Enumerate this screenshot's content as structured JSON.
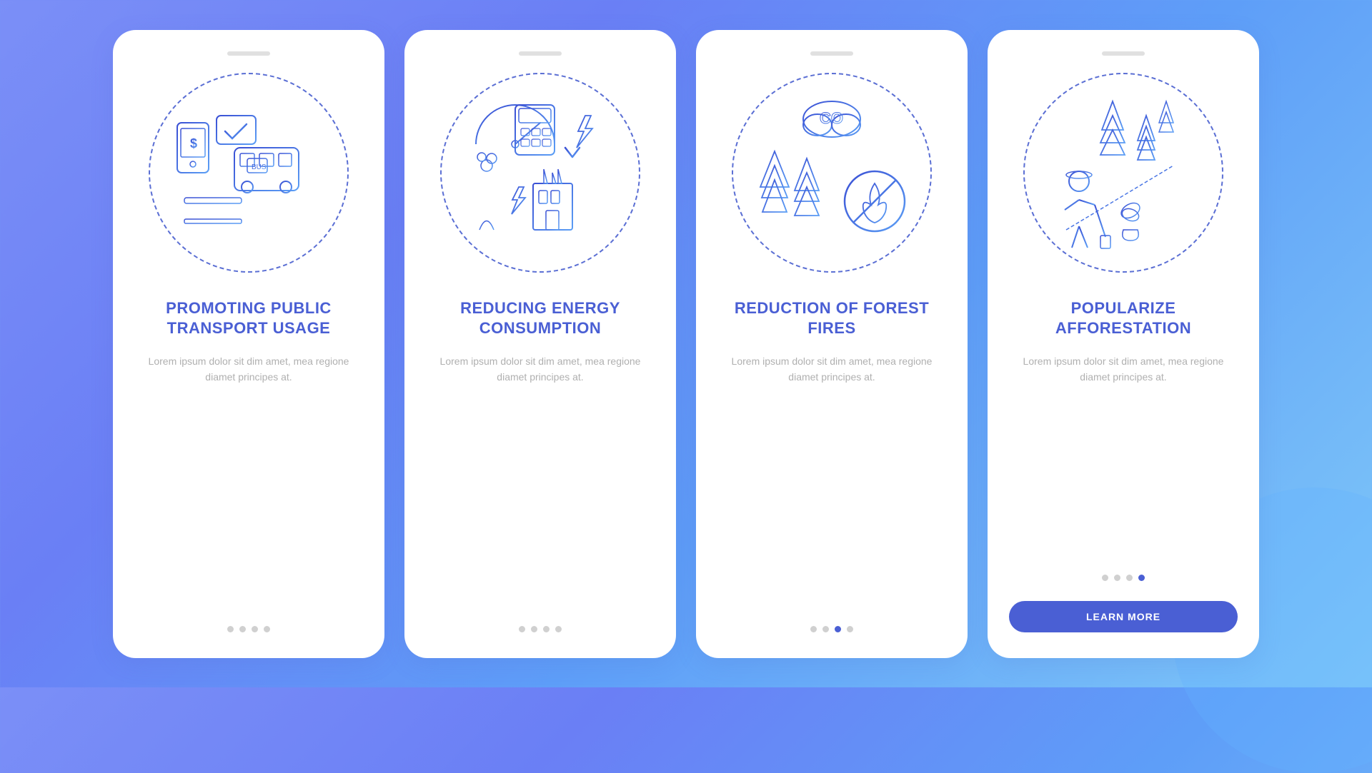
{
  "background": {
    "gradient_start": "#7b8ff7",
    "gradient_end": "#7fc8f8"
  },
  "cards": [
    {
      "id": "card-1",
      "notch": true,
      "title": "PROMOTING PUBLIC TRANSPORT USAGE",
      "body": "Lorem ipsum dolor sit dim amet, mea regione diamet principes at.",
      "dots": [
        false,
        false,
        false,
        false
      ],
      "active_dot": -1,
      "show_button": false,
      "button_label": null,
      "illustration": "transport"
    },
    {
      "id": "card-2",
      "notch": true,
      "title": "REDUCING ENERGY CONSUMPTION",
      "body": "Lorem ipsum dolor sit dim amet, mea regione diamet principes at.",
      "dots": [
        false,
        false,
        false,
        false
      ],
      "active_dot": -1,
      "show_button": false,
      "button_label": null,
      "illustration": "energy"
    },
    {
      "id": "card-3",
      "notch": true,
      "title": "REDUCTION OF FOREST FIRES",
      "body": "Lorem ipsum dolor sit dim amet, mea regione diamet principes at.",
      "dots": [
        false,
        false,
        false,
        false
      ],
      "active_dot": -1,
      "show_button": false,
      "button_label": null,
      "illustration": "forest"
    },
    {
      "id": "card-4",
      "notch": true,
      "title": "POPULARIZE AFFORESTATION",
      "body": "Lorem ipsum dolor sit dim amet, mea regione diamet principes at.",
      "dots": [
        false,
        false,
        false,
        false
      ],
      "active_dot": 3,
      "show_button": true,
      "button_label": "LEARN MORE",
      "illustration": "afforestation"
    }
  ]
}
